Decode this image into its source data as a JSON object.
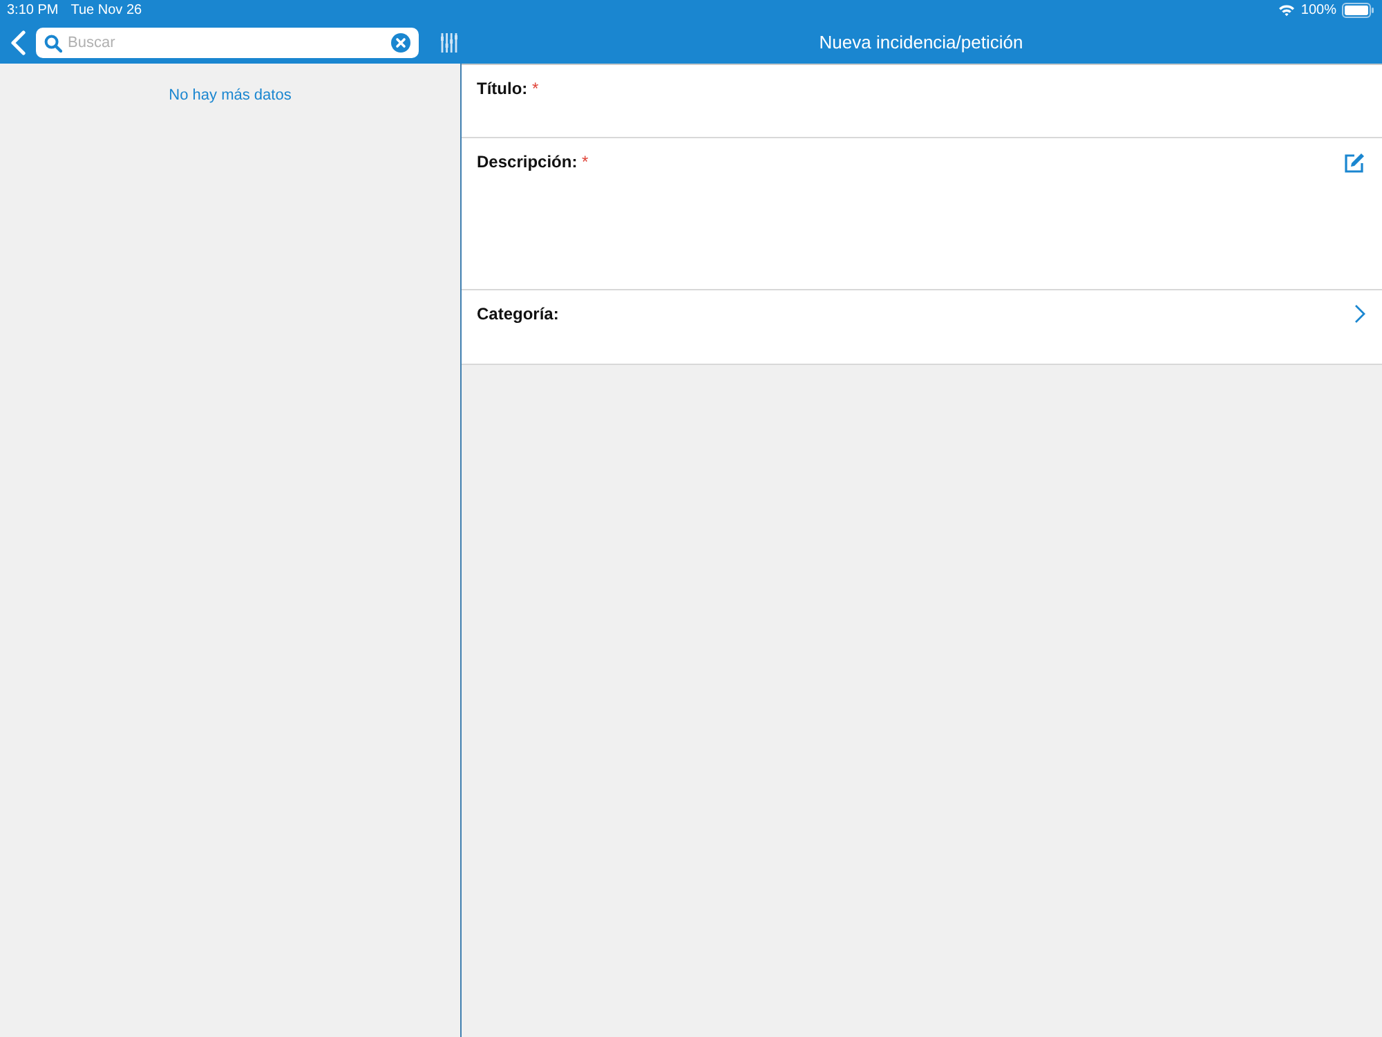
{
  "status_bar": {
    "time": "3:10 PM",
    "date": "Tue Nov 26",
    "battery": "100%"
  },
  "search": {
    "placeholder": "Buscar"
  },
  "list": {
    "empty_message": "No hay más datos"
  },
  "form": {
    "title": "Nueva incidencia/petición",
    "fields": [
      {
        "kind": "text",
        "label": "Título:",
        "required_mark": "*"
      },
      {
        "kind": "multiline",
        "label": "Descripción:",
        "required_mark": "*"
      },
      {
        "kind": "picker",
        "label": "Categoría:"
      }
    ]
  }
}
